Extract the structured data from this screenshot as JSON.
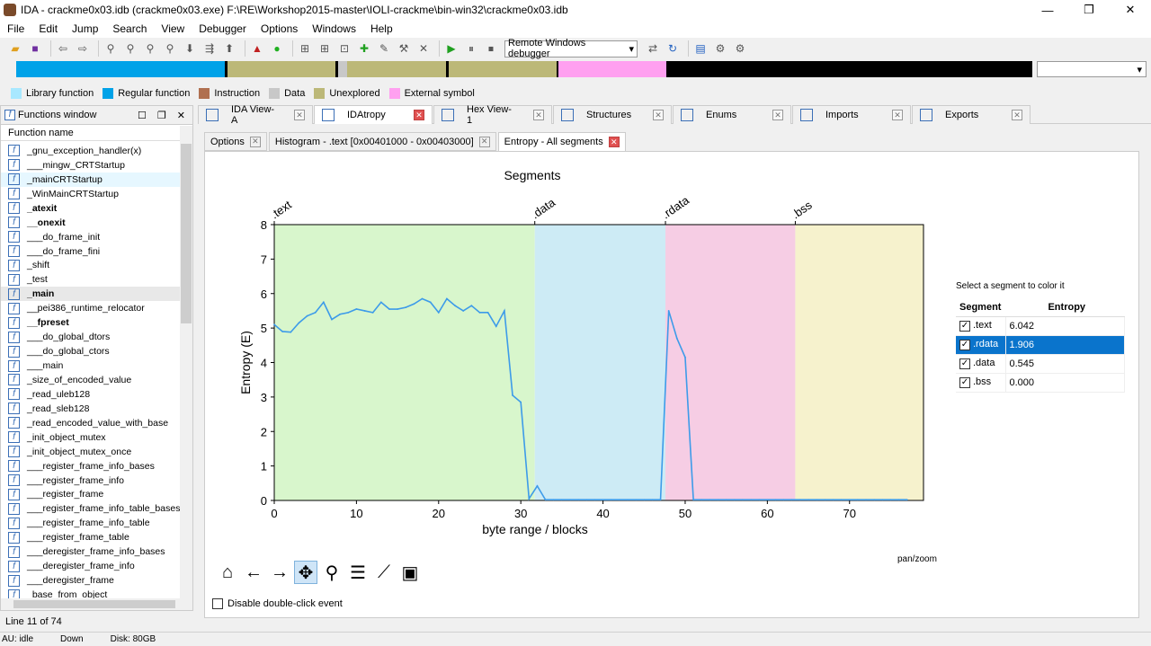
{
  "window": {
    "title": "IDA - crackme0x03.idb (crackme0x03.exe) F:\\RE\\Workshop2015-master\\IOLI-crackme\\bin-win32\\crackme0x03.idb",
    "controls": [
      "—",
      "❐",
      "✕"
    ]
  },
  "menu": [
    "File",
    "Edit",
    "Jump",
    "Search",
    "View",
    "Debugger",
    "Options",
    "Windows",
    "Help"
  ],
  "toolbar": {
    "debugger": "Remote Windows debugger"
  },
  "legend": [
    {
      "label": "Library function",
      "color": "#a8e8ff"
    },
    {
      "label": "Regular function",
      "color": "#00a2e8"
    },
    {
      "label": "Instruction",
      "color": "#b07050"
    },
    {
      "label": "Data",
      "color": "#c8c8c8"
    },
    {
      "label": "Unexplored",
      "color": "#bcb878"
    },
    {
      "label": "External symbol",
      "color": "#ffa0f0"
    }
  ],
  "functions_window": {
    "title": "Functions window",
    "column": "Function name",
    "items": [
      {
        "name": "_gnu_exception_handler(x)",
        "bold": false
      },
      {
        "name": "___mingw_CRTStartup",
        "bold": false
      },
      {
        "name": "_mainCRTStartup",
        "bold": false
      },
      {
        "name": "_WinMainCRTStartup",
        "bold": false
      },
      {
        "name": "_atexit",
        "bold": true
      },
      {
        "name": "__onexit",
        "bold": true
      },
      {
        "name": "___do_frame_init",
        "bold": false
      },
      {
        "name": "___do_frame_fini",
        "bold": false
      },
      {
        "name": "_shift",
        "bold": false
      },
      {
        "name": "_test",
        "bold": false
      },
      {
        "name": "_main",
        "bold": true
      },
      {
        "name": "__pei386_runtime_relocator",
        "bold": false
      },
      {
        "name": "__fpreset",
        "bold": true
      },
      {
        "name": "___do_global_dtors",
        "bold": false
      },
      {
        "name": "___do_global_ctors",
        "bold": false
      },
      {
        "name": "___main",
        "bold": false
      },
      {
        "name": "_size_of_encoded_value",
        "bold": false
      },
      {
        "name": "_read_uleb128",
        "bold": false
      },
      {
        "name": "_read_sleb128",
        "bold": false
      },
      {
        "name": "_read_encoded_value_with_base",
        "bold": false
      },
      {
        "name": "_init_object_mutex",
        "bold": false
      },
      {
        "name": "_init_object_mutex_once",
        "bold": false
      },
      {
        "name": "___register_frame_info_bases",
        "bold": false
      },
      {
        "name": "___register_frame_info",
        "bold": false
      },
      {
        "name": "___register_frame",
        "bold": false
      },
      {
        "name": "___register_frame_info_table_bases",
        "bold": false
      },
      {
        "name": "___register_frame_info_table",
        "bold": false
      },
      {
        "name": "___register_frame_table",
        "bold": false
      },
      {
        "name": "___deregister_frame_info_bases",
        "bold": false
      },
      {
        "name": "___deregister_frame_info",
        "bold": false
      },
      {
        "name": "___deregister_frame",
        "bold": false
      },
      {
        "name": "_base_from_object",
        "bold": false
      }
    ],
    "status": "Line 11 of 74"
  },
  "statusbar": {
    "au": "AU:  idle",
    "dir": "Down",
    "disk": "Disk: 80GB"
  },
  "tabs": [
    {
      "label": "IDA View-A",
      "active": false
    },
    {
      "label": "IDAtropy",
      "active": true
    },
    {
      "label": "Hex View-1",
      "active": false
    },
    {
      "label": "Structures",
      "active": false
    },
    {
      "label": "Enums",
      "active": false
    },
    {
      "label": "Imports",
      "active": false
    },
    {
      "label": "Exports",
      "active": false
    }
  ],
  "subtabs": [
    {
      "label": "Options",
      "active": false
    },
    {
      "label": "Histogram - .text [0x00401000 - 0x00403000]",
      "active": false
    },
    {
      "label": "Entropy - All segments",
      "active": true
    }
  ],
  "segment_table": {
    "caption": "Select a segment to color it",
    "headers": [
      "Segment",
      "Entropy"
    ],
    "rows": [
      {
        "segment": ".text",
        "entropy": "6.042",
        "checked": true,
        "selected": false
      },
      {
        "segment": ".rdata",
        "entropy": "1.906",
        "checked": true,
        "selected": true
      },
      {
        "segment": ".data",
        "entropy": "0.545",
        "checked": true,
        "selected": false
      },
      {
        "segment": ".bss",
        "entropy": "0.000",
        "checked": true,
        "selected": false
      }
    ]
  },
  "plot_controls": {
    "mode": "pan/zoom",
    "disable_dblclick": "Disable double-click event"
  },
  "chart_data": {
    "type": "line",
    "title": "Segments",
    "xlabel": "byte range / blocks",
    "ylabel": "Entropy (E)",
    "xlim": [
      0,
      79
    ],
    "ylim": [
      0,
      8
    ],
    "xticks": [
      0,
      10,
      20,
      30,
      40,
      50,
      60,
      70
    ],
    "yticks": [
      0,
      1,
      2,
      3,
      4,
      5,
      6,
      7,
      8
    ],
    "segments": [
      {
        "name": ".text",
        "start": 0,
        "end": 31.7,
        "color": "#d8f6cc"
      },
      {
        "name": ".data",
        "start": 31.7,
        "end": 47.6,
        "color": "#cdebf5"
      },
      {
        "name": ".rdata",
        "start": 47.6,
        "end": 63.4,
        "color": "#f6cde4"
      },
      {
        "name": ".bss",
        "start": 63.4,
        "end": 79,
        "color": "#f6f2cd"
      }
    ],
    "series": [
      {
        "color": "#3d9be9",
        "x": [
          0,
          1,
          2,
          3,
          4,
          5,
          6,
          7,
          8,
          9,
          10,
          11,
          12,
          13,
          14,
          15,
          16,
          17,
          18,
          19,
          20,
          21,
          22,
          23,
          24,
          25,
          26,
          27,
          28,
          29,
          30,
          31,
          32,
          33,
          34,
          35,
          36,
          37,
          38,
          39,
          40,
          41,
          42,
          43,
          44,
          45,
          46,
          47,
          48,
          49,
          50,
          51,
          52,
          53,
          54,
          55,
          56,
          57,
          58,
          59,
          60,
          61,
          62,
          63,
          64,
          65,
          66,
          67,
          68,
          69,
          70,
          71,
          72,
          73,
          74,
          75,
          76,
          77
        ],
        "y": [
          5.1,
          4.9,
          4.88,
          5.15,
          5.35,
          5.45,
          5.75,
          5.25,
          5.4,
          5.45,
          5.55,
          5.5,
          5.45,
          5.75,
          5.55,
          5.55,
          5.6,
          5.7,
          5.85,
          5.75,
          5.45,
          5.85,
          5.65,
          5.5,
          5.65,
          5.45,
          5.45,
          5.05,
          5.5,
          3.05,
          2.85,
          0.05,
          0.42,
          0.02,
          0.02,
          0.02,
          0.02,
          0.02,
          0.02,
          0.02,
          0.02,
          0.02,
          0.02,
          0.02,
          0.02,
          0.02,
          0.02,
          0.02,
          5.5,
          4.7,
          4.15,
          0.02,
          0.02,
          0.02,
          0.02,
          0.02,
          0.02,
          0.02,
          0.02,
          0.02,
          0.02,
          0.02,
          0.02,
          0.02,
          0.02,
          0.02,
          0.02,
          0.02,
          0.02,
          0.02,
          0.02,
          0.02,
          0.02,
          0.02,
          0.02,
          0.02,
          0.02,
          0.02
        ]
      }
    ]
  }
}
